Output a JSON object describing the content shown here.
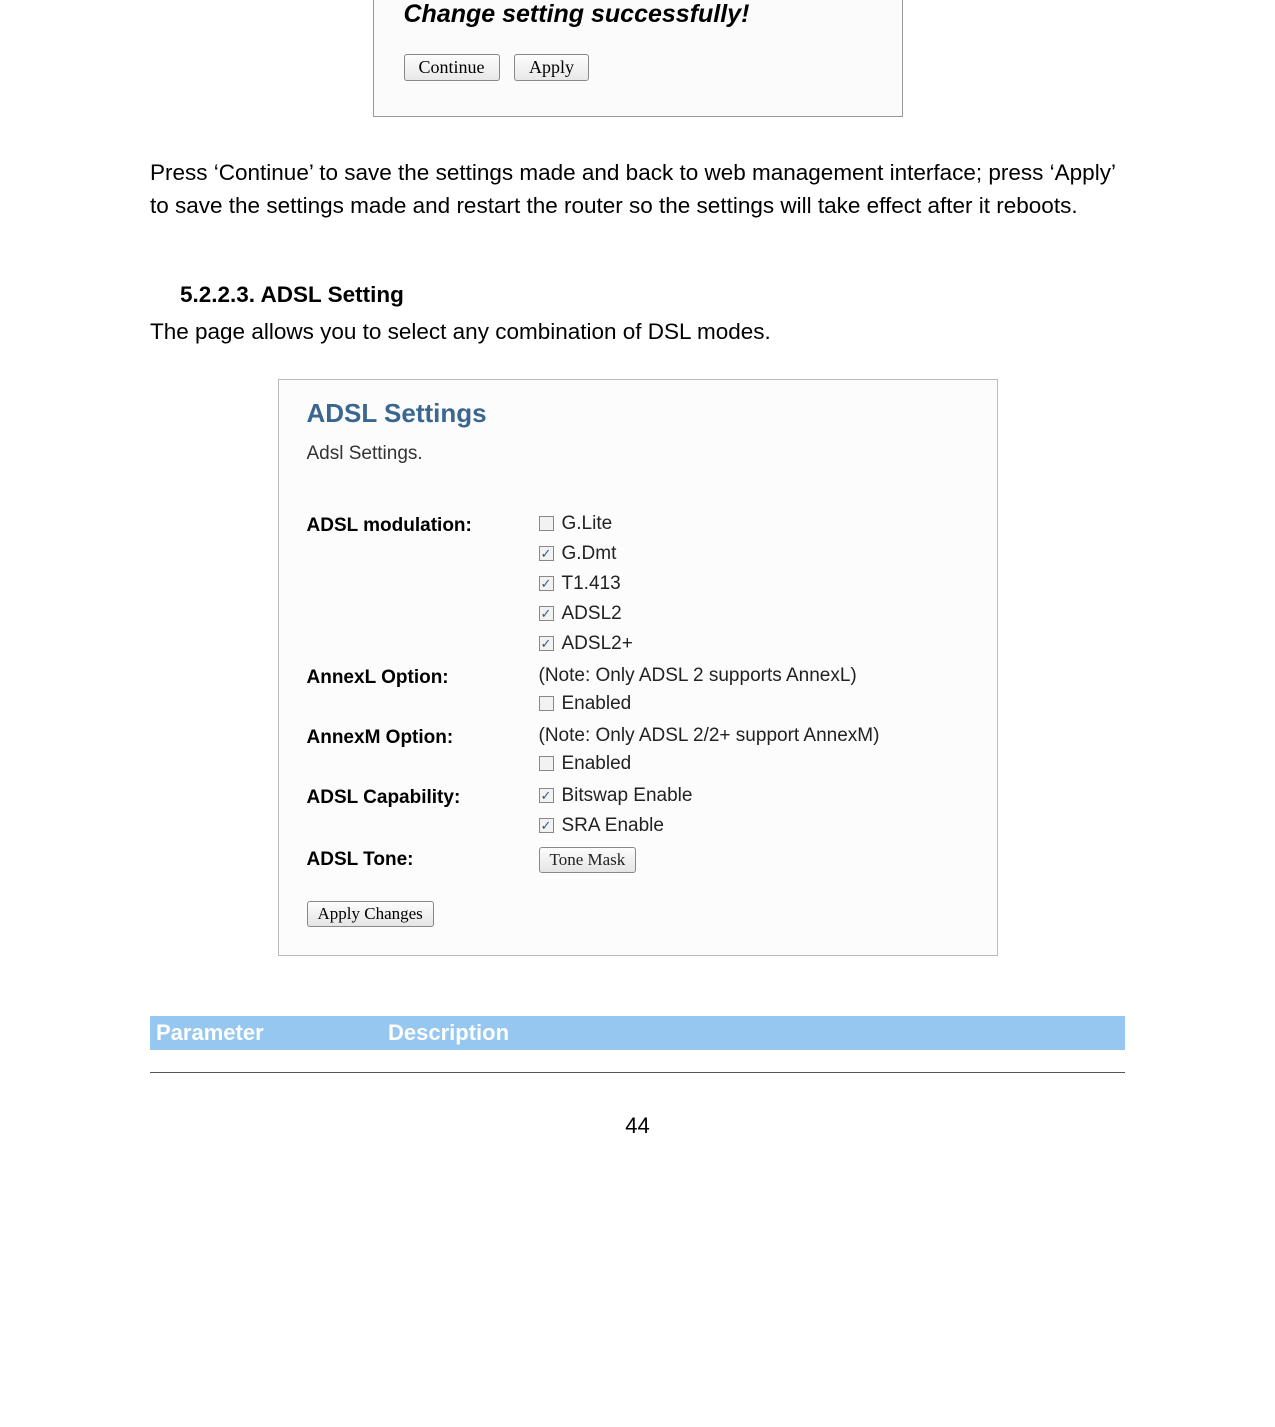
{
  "dialog": {
    "title": "Change setting successfully!",
    "continue_label": "Continue",
    "apply_label": "Apply"
  },
  "para1": "Press ‘Continue’ to save the settings made and back to web management interface; press ‘Apply’ to save the settings made and restart the router so the settings will take effect after it reboots.",
  "section_heading": "5.2.2.3. ADSL Setting",
  "section_intro": "The page allows you to select any combination of DSL modes.",
  "panel": {
    "title": "ADSL Settings",
    "desc": "Adsl Settings.",
    "modulation_label": "ADSL modulation:",
    "annexl_label": "AnnexL Option:",
    "annexm_label": "AnnexM Option:",
    "capability_label": "ADSL Capability:",
    "tone_label": "ADSL Tone:",
    "annexl_note": "(Note: Only ADSL 2 supports AnnexL)",
    "annexm_note": "(Note: Only ADSL 2/2+ support AnnexM)",
    "opts": {
      "glite": "G.Lite",
      "gdmt": "G.Dmt",
      "t1413": "T1.413",
      "adsl2": "ADSL2",
      "adsl2p": "ADSL2+",
      "enabled": "Enabled",
      "bitswap": "Bitswap Enable",
      "sra": "SRA Enable"
    },
    "tone_mask_btn": "Tone Mask",
    "apply_changes_btn": "Apply Changes"
  },
  "table": {
    "col1": "Parameter",
    "col2": "Description"
  },
  "page_number": "44",
  "checks": {
    "checked": "✓",
    "unchecked": ""
  }
}
